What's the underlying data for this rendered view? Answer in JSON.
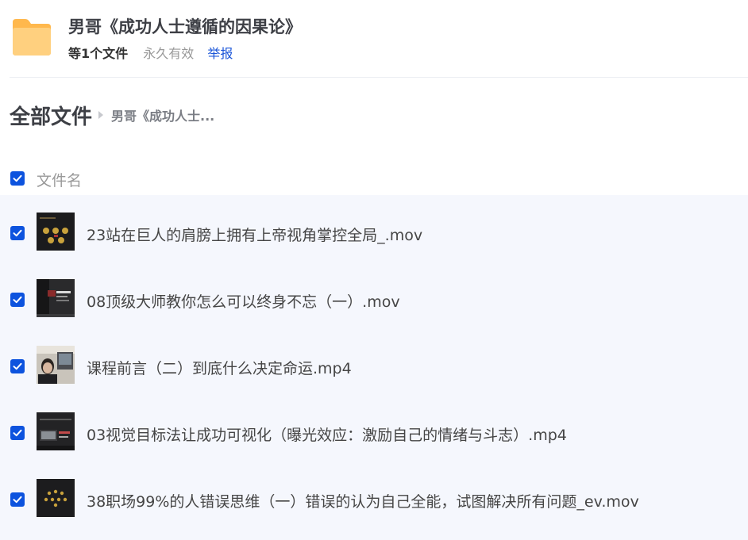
{
  "share": {
    "title": "男哥《成功人士遵循的因果论》",
    "file_count": "等1个文件",
    "validity": "永久有效",
    "report": "举报",
    "folder_color": "#ffc86b"
  },
  "breadcrumb": {
    "root": "全部文件",
    "current": "男哥《成功人士..."
  },
  "list_header": {
    "name_column": "文件名",
    "all_checked": true
  },
  "files": [
    {
      "name": "23站在巨人的肩膀上拥有上帝视角掌控全局_.mov",
      "checked": true,
      "thumb": "gold-circles-dark"
    },
    {
      "name": "08顶级大师教你怎么可以终身不忘（一）.mov",
      "checked": true,
      "thumb": "dark-slide-text"
    },
    {
      "name": "课程前言（二）到底什么决定命运.mp4",
      "checked": true,
      "thumb": "person-room"
    },
    {
      "name": "03视觉目标法让成功可视化（曝光效应：激励自己的情绪与斗志）.mp4",
      "checked": true,
      "thumb": "dark-desk-slide"
    },
    {
      "name": "38职场99%的人错误思维（一）错误的认为自己全能，试图解决所有问题_ev.mov",
      "checked": true,
      "thumb": "gold-dots-dark"
    }
  ],
  "colors": {
    "accent": "#0d53de",
    "link": "#1a55d8",
    "list_bg": "#f5f7fd"
  }
}
